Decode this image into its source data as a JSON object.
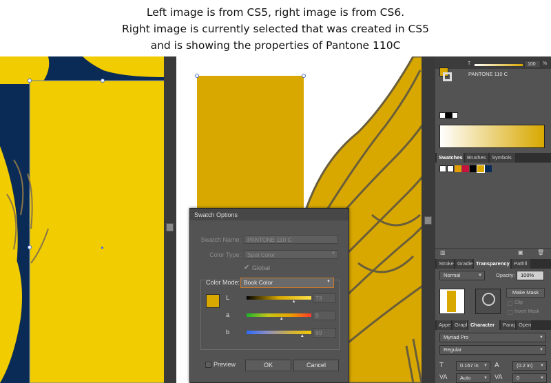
{
  "caption": {
    "line1": "Left image is from CS5, right image is from CS6.",
    "line2": "Right image is currently selected that was created in CS5",
    "line3": "and is showing the properties of Pantone 110C"
  },
  "dialog": {
    "title": "Swatch Options",
    "swatch_name_label": "Swatch Name:",
    "swatch_name_value": "PANTONE 110 C",
    "color_type_label": "Color Type:",
    "color_type_value": "Spot Color",
    "global_label": "Global",
    "global_checked": true,
    "color_mode_label": "Color Mode:",
    "color_mode_value": "Book Color",
    "swatch_color": "#d8a800",
    "channels": [
      {
        "label": "L",
        "value": "73",
        "fraction": 0.73
      },
      {
        "label": "a",
        "value": "9",
        "fraction": 0.54
      },
      {
        "label": "b",
        "value": "89",
        "fraction": 0.86
      }
    ],
    "preview_label": "Preview",
    "ok_label": "OK",
    "cancel_label": "Cancel"
  },
  "colors": {
    "pantone": "#d8a800",
    "cs5_yellow": "#f0cc00",
    "navy": "#0b2b57",
    "outline": "#6a5e3a",
    "panel_bg": "#535353",
    "accent_border": "#c9782b"
  },
  "panel": {
    "opacity_label": "T",
    "tint_value": "100",
    "tint_unit": "%",
    "swatch_name": "PANTONE 110 C",
    "tabs1": [
      "Swatches",
      "Brushes",
      "Symbols"
    ],
    "tabs2": [
      "Stroke",
      "Gradie",
      "Transparency",
      "Pathfi"
    ],
    "blend_mode": "Normal",
    "opacity_text": "Opacity:",
    "opacity_value": "100%",
    "make_mask": "Make Mask",
    "clip": "Clip",
    "invert_mask": "Invert Mask",
    "tabs3": [
      "Appe",
      "Grapl",
      "Character",
      "Parag",
      "Open"
    ],
    "font_family": "Myriad Pro",
    "font_style": "Regular",
    "font_size": "0.167 in",
    "leading": "(0.2 in)",
    "kerning": "Auto",
    "tracking": "0"
  }
}
